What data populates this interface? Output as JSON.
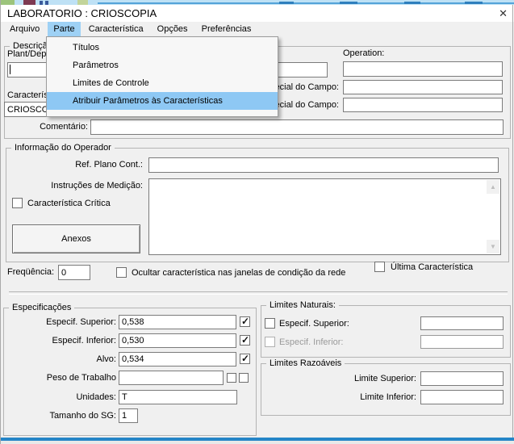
{
  "window": {
    "title": "LABORATORIO : CRIOSCOPIA",
    "close_glyph": "✕"
  },
  "menubar": {
    "items": [
      {
        "label": "Arquivo"
      },
      {
        "label": "Parte",
        "selected": true
      },
      {
        "label": "Característica"
      },
      {
        "label": "Opções"
      },
      {
        "label": "Preferências"
      }
    ],
    "highlight_color": "#9ed1f5"
  },
  "menu": {
    "items": [
      {
        "label": "Títulos"
      },
      {
        "label": "Parâmetros"
      },
      {
        "label": "Limites de Controle"
      },
      {
        "label": "Atribuir Parâmetros às Características",
        "highlighted": true
      }
    ],
    "highlight_color": "#8ec8f4"
  },
  "descricao": {
    "legend": "Descrição",
    "plant_label": "Plant/Dep",
    "plant_value": "",
    "operation_label": "Operation:",
    "operation_value": "",
    "campo_label_row2": "Especial do Campo:",
    "campo_value_row2": "",
    "campo_label_row3": "Especial do Campo:",
    "campo_value_row3": "",
    "caracteristica_label": "Característica:",
    "caracteristica_value": "CRIOSCOPIA"
  },
  "comentario": {
    "label": "Comentário:",
    "value": ""
  },
  "info_operador": {
    "legend": "Informação do Operador",
    "ref_label": "Ref. Plano Cont.:",
    "ref_value": "",
    "instrucoes_label": "Instruções de Medição:",
    "instrucoes_value": "",
    "critica_label": "Característica Crítica",
    "critica_checked": false,
    "anexos_label": "Anexos"
  },
  "frequencia": {
    "label": "Freqüência:",
    "value": "0",
    "ocultar_label": "Ocultar característica nas janelas de condição da rede",
    "ocultar_checked": false,
    "ultima_label": "Última Característica",
    "ultima_checked": false
  },
  "especificacoes": {
    "legend": "Especificações",
    "superior": {
      "label": "Especif. Superior:",
      "value": "0,538",
      "checked": true
    },
    "inferior": {
      "label": "Especif. Inferior:",
      "value": "0,530",
      "checked": true
    },
    "alvo": {
      "label": "Alvo:",
      "value": "0,534",
      "checked": true
    },
    "peso": {
      "label": "Peso de Trabalho",
      "value": "",
      "checked1": false,
      "checked2": false
    },
    "unidades": {
      "label": "Unidades:",
      "value": "T"
    },
    "sg": {
      "label": "Tamanho do SG:",
      "value": "1"
    }
  },
  "limites_naturais": {
    "legend": "Limites Naturais:",
    "superior": {
      "label": "Especif. Superior:",
      "value": "",
      "checked": false,
      "disabled": false
    },
    "inferior": {
      "label": "Especif. Inferior:",
      "value": "",
      "checked": false,
      "disabled": true
    }
  },
  "limites_razoaveis": {
    "legend": "Limites Razoáveis",
    "superior": {
      "label": "Limite Superior:",
      "value": ""
    },
    "inferior": {
      "label": "Limite Inferior:",
      "value": ""
    }
  },
  "colors": {
    "bottom_accent": "#2585c7",
    "backdrop_strip": "#bee1f5"
  }
}
